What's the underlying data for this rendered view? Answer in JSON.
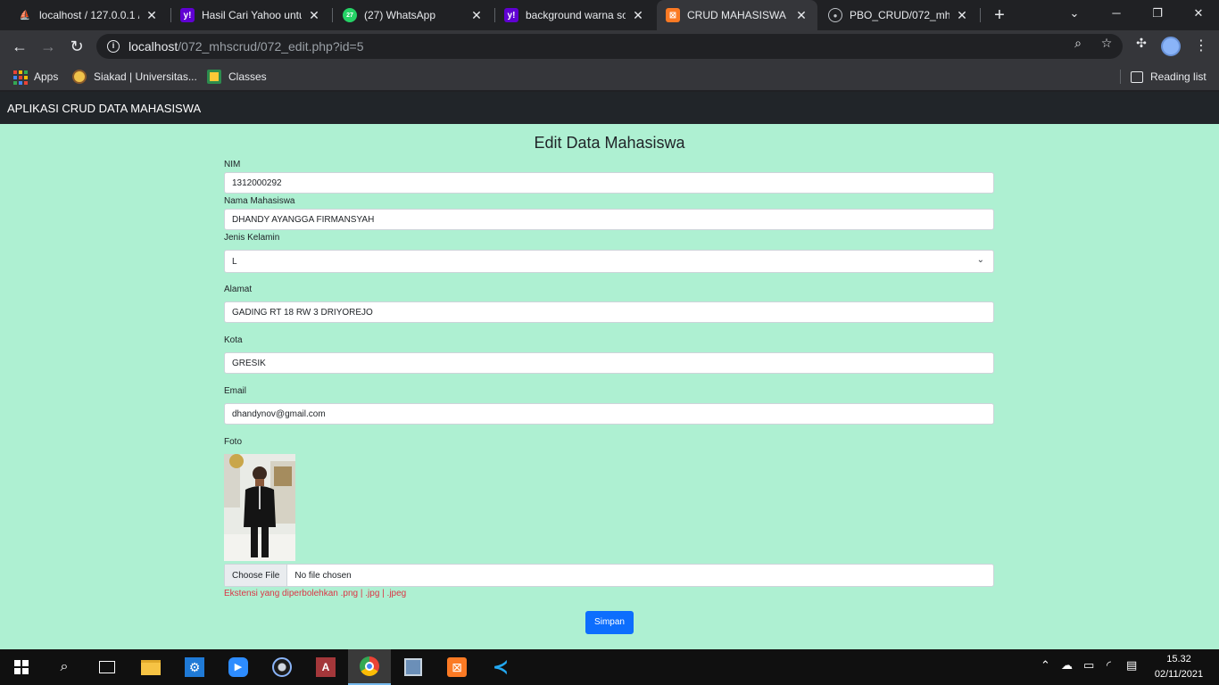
{
  "browser": {
    "tabs": [
      {
        "title": "localhost / 127.0.0.1 / (",
        "icon": "phpmyadmin-icon"
      },
      {
        "title": "Hasil Cari Yahoo untuk",
        "icon": "yahoo-icon"
      },
      {
        "title": "(27) WhatsApp",
        "icon": "whatsapp-icon"
      },
      {
        "title": "background warna soft",
        "icon": "yahoo-icon"
      },
      {
        "title": "CRUD MAHASISWA",
        "icon": "xampp-icon",
        "active": true
      },
      {
        "title": "PBO_CRUD/072_mhscr",
        "icon": "github-icon"
      }
    ],
    "address": {
      "host": "localhost",
      "path": "/072_mhscrud/072_edit.php?id=5"
    },
    "bookmarks": [
      {
        "label": "Apps",
        "icon": "apps-grid-icon"
      },
      {
        "label": "Siakad | Universitas...",
        "icon": "siakad-icon"
      },
      {
        "label": "Classes",
        "icon": "classes-icon"
      }
    ],
    "reading_list": "Reading list"
  },
  "app": {
    "brand": "APLIKASI CRUD DATA MAHASISWA"
  },
  "form": {
    "heading": "Edit Data Mahasiswa",
    "nim_label": "NIM",
    "nim_value": "1312000292",
    "nama_label": "Nama Mahasiswa",
    "nama_value": "DHANDY AYANGGA FIRMANSYAH",
    "jk_label": "Jenis Kelamin",
    "jk_value": "L",
    "alamat_label": "Alamat",
    "alamat_value": "GADING RT 18 RW 3 DRIYOREJO",
    "kota_label": "Kota",
    "kota_value": "GRESIK",
    "email_label": "Email",
    "email_value": "dhandynov@gmail.com",
    "foto_label": "Foto",
    "choose_file": "Choose File",
    "no_file": "No file chosen",
    "hint": "Ekstensi yang diperbolehkan .png | .jpg | .jpeg",
    "save_label": "Simpan"
  },
  "taskbar": {
    "time": "15.32",
    "date": "02/11/2021"
  },
  "colors": {
    "page_bg": "#aef0d2",
    "primary": "#0d6efd",
    "danger": "#dc3545",
    "navbar": "#212529"
  }
}
